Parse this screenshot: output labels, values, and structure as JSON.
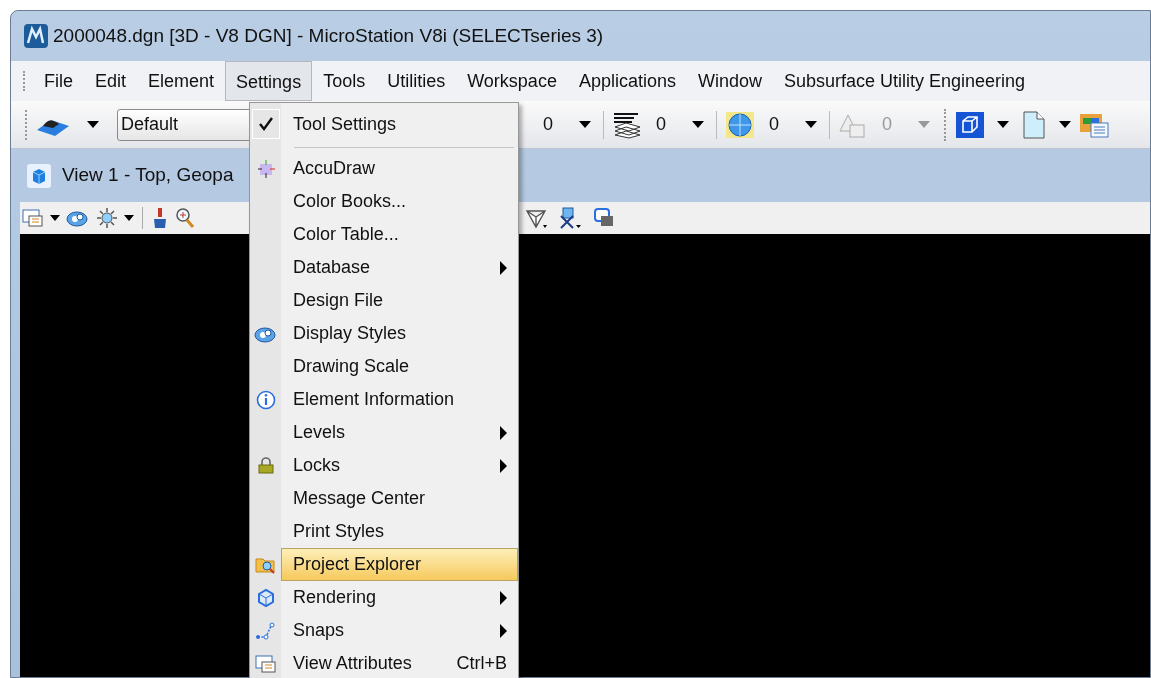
{
  "window": {
    "title": "2000048.dgn [3D - V8 DGN] - MicroStation V8i (SELECTseries 3)"
  },
  "menu_bar": [
    {
      "label": "File",
      "selected": false
    },
    {
      "label": "Edit",
      "selected": false
    },
    {
      "label": "Element",
      "selected": false
    },
    {
      "label": "Settings",
      "selected": true
    },
    {
      "label": "Tools",
      "selected": false
    },
    {
      "label": "Utilities",
      "selected": false
    },
    {
      "label": "Workspace",
      "selected": false
    },
    {
      "label": "Applications",
      "selected": false
    },
    {
      "label": "Window",
      "selected": false
    },
    {
      "label": "Subsurface Utility Engineering",
      "selected": false
    }
  ],
  "toolbar": {
    "style_field": "Default",
    "dropdowns": [
      {
        "value": "0",
        "disabled": false
      },
      {
        "value": "0",
        "disabled": false
      },
      {
        "value": "0",
        "disabled": false
      },
      {
        "value": "0",
        "disabled": true
      }
    ]
  },
  "view": {
    "title": "View 1 - Top, Geopa"
  },
  "settings_menu": {
    "groups": [
      [
        {
          "label": "Tool Settings",
          "checked": true,
          "submenu": false,
          "selected": false
        }
      ],
      [
        {
          "label": "AccuDraw",
          "checked": false,
          "submenu": false,
          "selected": false
        },
        {
          "label": "Color Books...",
          "checked": false,
          "submenu": false,
          "selected": false
        },
        {
          "label": "Color Table...",
          "checked": false,
          "submenu": false,
          "selected": false
        },
        {
          "label": "Database",
          "checked": false,
          "submenu": true,
          "selected": false
        },
        {
          "label": "Design File",
          "checked": false,
          "submenu": false,
          "selected": false
        },
        {
          "label": "Display Styles",
          "checked": false,
          "submenu": false,
          "selected": false
        },
        {
          "label": "Drawing Scale",
          "checked": false,
          "submenu": false,
          "selected": false
        },
        {
          "label": "Element Information",
          "checked": false,
          "submenu": false,
          "selected": false
        },
        {
          "label": "Levels",
          "checked": false,
          "submenu": true,
          "selected": false
        },
        {
          "label": "Locks",
          "checked": false,
          "submenu": true,
          "selected": false
        },
        {
          "label": "Message Center",
          "checked": false,
          "submenu": false,
          "selected": false
        },
        {
          "label": "Print Styles",
          "checked": false,
          "submenu": false,
          "selected": false
        },
        {
          "label": "Project Explorer",
          "checked": false,
          "submenu": false,
          "selected": true
        },
        {
          "label": "Rendering",
          "checked": false,
          "submenu": true,
          "selected": false
        },
        {
          "label": "Snaps",
          "checked": false,
          "submenu": true,
          "selected": false
        },
        {
          "label": "View Attributes",
          "checked": false,
          "submenu": false,
          "selected": false,
          "shortcut": "Ctrl+B"
        }
      ]
    ]
  }
}
